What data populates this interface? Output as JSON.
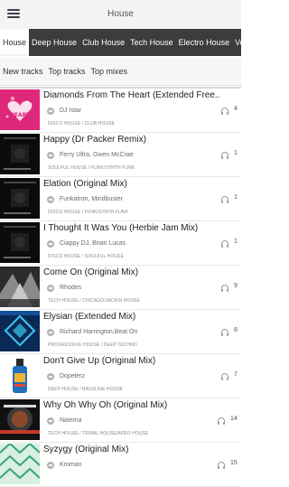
{
  "header": {
    "title": "House"
  },
  "genre_tabs": [
    "House",
    "Deep House",
    "Club House",
    "Tech House",
    "Electro House",
    "Vo"
  ],
  "sub_tabs": [
    "New tracks",
    "Top tracks",
    "Top mixes"
  ],
  "tracks": [
    {
      "title": "Diamonds From The Heart (Extended Free..",
      "artist": "DJ Istar",
      "genres": "DISCO HOUSE / CLUB HOUSE",
      "plays": "4",
      "art": "pink-heart-art"
    },
    {
      "title": "Happy (Dr Packer Remix)",
      "artist": "Ferry Ultra, Gwen McCrae",
      "genres": "SOULFUL HOUSE / FUNK/SYNTH FUNK",
      "plays": "1",
      "art": "black-compilation-art"
    },
    {
      "title": "Elation (Original Mix)",
      "artist": "Funkatron, Mindbuster",
      "genres": "DISCO HOUSE / FUNK/SYNTH FUNK",
      "plays": "1",
      "art": "black-compilation-art"
    },
    {
      "title": "I Thought It Was You (Herbie Jam Mix)",
      "artist": "Ciappy DJ, Brian Lucas",
      "genres": "DISCO HOUSE / SOULFUL HOUSE",
      "plays": "1",
      "art": "black-compilation-art"
    },
    {
      "title": "Come On (Original Mix)",
      "artist": "Rhodes",
      "genres": "TECH HOUSE / CHICAGO/JACKIN HOUSE",
      "plays": "9",
      "art": "rhodes-art"
    },
    {
      "title": "Elysian (Extended Mix)",
      "artist": "Richard Harrington,Beat On",
      "genres": "PROGRESSIVE HOUSE / DEEP TECHNO",
      "plays": "8",
      "art": "blue-geometric-art"
    },
    {
      "title": "Don't Give Up (Original Mix)",
      "artist": "Dopelerz",
      "genres": "DEEP HOUSE / BASSLINE HOUSE",
      "plays": "7",
      "art": "bottle-art"
    },
    {
      "title": "Why Oh Why Oh (Original Mix)",
      "artist": "Natema",
      "genres": "TECH HOUSE / TRIBAL HOUSE/AFRO HOUSE",
      "plays": "14",
      "art": "natema-art"
    },
    {
      "title": "Syzygy (Original Mix)",
      "artist": "Kroman",
      "genres": "",
      "plays": "15",
      "art": "green-pattern-art"
    }
  ],
  "colors": {
    "tab_bar": "#3c3c3c",
    "app_bar": "#f4f4f4",
    "art_pink": "#e0287a"
  }
}
